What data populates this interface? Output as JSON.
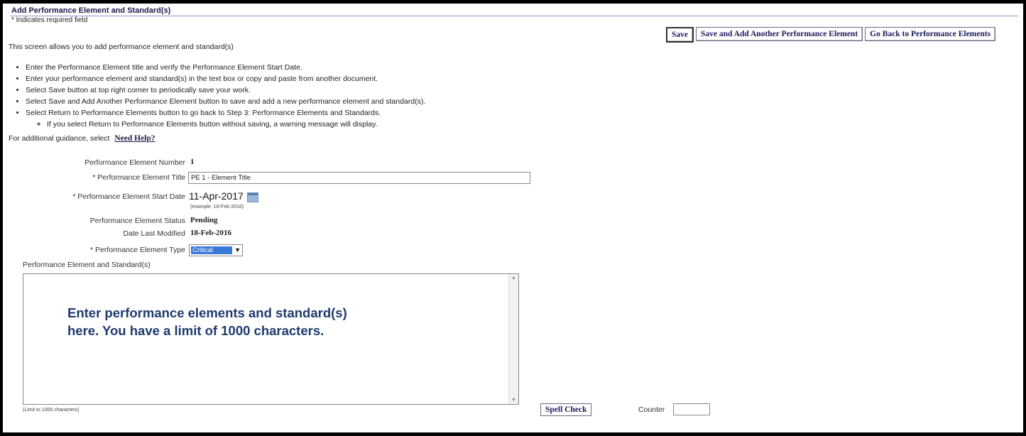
{
  "page": {
    "title": "Add Performance Element and Standard(s)",
    "required_note": "* Indicates required field",
    "intro": "This screen allows you to add performance element and standard(s)"
  },
  "buttons": {
    "save": "Save",
    "save_add_another": "Save and Add Another Performance Element",
    "go_back": "Go Back to Performance Elements"
  },
  "instructions": [
    "Enter the Performance Element title and verify the Performance Element Start Date.",
    "Enter your performance element and standard(s) in the text box or copy and paste from another document.",
    "Select Save button at top right corner to periodically save your work.",
    "Select Save and Add Another Performance Element button to save and add a new performance element and standard(s).",
    "Select Return to Performance Elements button to go back to Step 3: Performance Elements and Standards."
  ],
  "sub_instruction": "If you select Return to Performance Elements button without saving, a warning message will display.",
  "help": {
    "prefix": "For additional guidance, select",
    "link": "Need Help?"
  },
  "form": {
    "number_label": "Performance Element Number",
    "number_value": "1",
    "title_label": "* Performance Element Title",
    "title_value": "PE 1 - Element Title",
    "start_date_label": "* Performance Element Start Date",
    "start_date_value": "11-Apr-2017",
    "start_date_example": "(example: 18-Feb-2016)",
    "status_label": "Performance Element Status",
    "status_value": "Pending",
    "modified_label": "Date Last Modified",
    "modified_value": "18-Feb-2016",
    "type_label": "* Performance Element Type",
    "type_value": "Critical"
  },
  "standards": {
    "label": "Performance Element and Standard(s)",
    "placeholder_text": "Enter performance elements and standard(s) here.  You have a limit of 1000 characters.",
    "limit_note": "(Limit to 1000 characters)",
    "spell_check": "Spell Check",
    "counter_label": "Counter"
  },
  "icons": {
    "calendar": "calendar-icon",
    "dropdown": "chevron-down-icon"
  },
  "colors": {
    "title_rule": "#a78bc8",
    "selected_option": "#3a78d8",
    "callout_text": "#1e3a6e"
  }
}
